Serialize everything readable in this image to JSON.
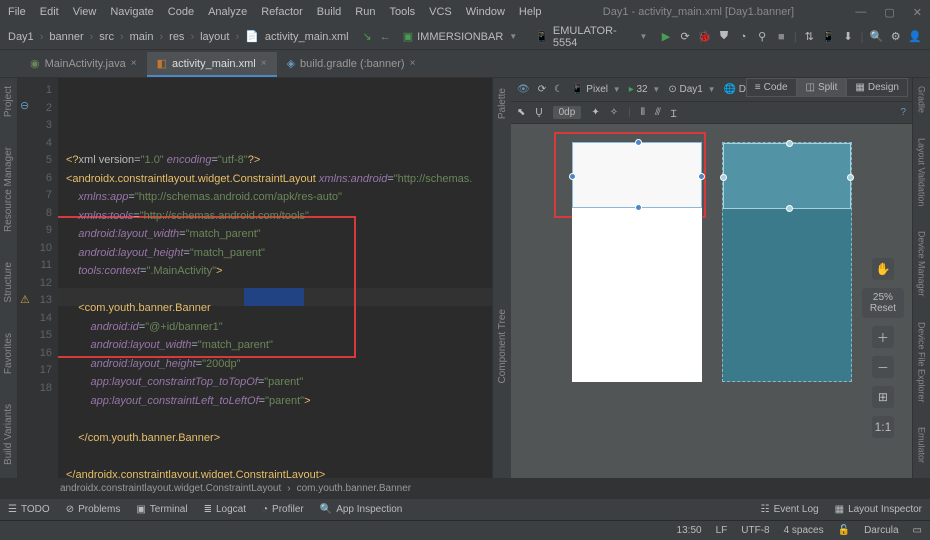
{
  "menu": [
    "File",
    "Edit",
    "View",
    "Navigate",
    "Code",
    "Analyze",
    "Refactor",
    "Build",
    "Run",
    "Tools",
    "VCS",
    "Window",
    "Help"
  ],
  "title": "Day1 - activity_main.xml [Day1.banner]",
  "breadcrumbs": [
    "Day1",
    "banner",
    "src",
    "main",
    "res",
    "layout",
    "activity_main.xml"
  ],
  "toolbar": {
    "config": "IMMERSIONBAR",
    "device": "EMULATOR-5554"
  },
  "tabs": [
    {
      "label": "MainActivity.java",
      "active": false
    },
    {
      "label": "activity_main.xml",
      "active": true
    },
    {
      "label": "build.gradle (:banner)",
      "active": false
    }
  ],
  "left_tools": [
    "Project",
    "Resource Manager",
    "Structure",
    "Favorites",
    "Build Variants"
  ],
  "right_tools": [
    "Gradle",
    "Layout Validation",
    "Device Manager",
    "Device File Explorer",
    "Emulator"
  ],
  "code": {
    "lines": [
      {
        "n": 1,
        "text": "<?xml version=\"1.0\" encoding=\"utf-8\"?>"
      },
      {
        "n": 2,
        "text": "<androidx.constraintlayout.widget.ConstraintLayout xmlns:android=\"http://schemas."
      },
      {
        "n": 3,
        "text": "    xmlns:app=\"http://schemas.android.com/apk/res-auto\""
      },
      {
        "n": 4,
        "text": "    xmlns:tools=\"http://schemas.android.com/tools\""
      },
      {
        "n": 5,
        "text": "    android:layout_width=\"match_parent\""
      },
      {
        "n": 6,
        "text": "    android:layout_height=\"match_parent\""
      },
      {
        "n": 7,
        "text": "    tools:context=\".MainActivity\">"
      },
      {
        "n": 8,
        "text": ""
      },
      {
        "n": 9,
        "text": "    <com.youth.banner.Banner"
      },
      {
        "n": 10,
        "text": "        android:id=\"@+id/banner1\""
      },
      {
        "n": 11,
        "text": "        android:layout_width=\"match_parent\""
      },
      {
        "n": 12,
        "text": "        android:layout_height=\"200dp\""
      },
      {
        "n": 13,
        "text": "        app:layout_constraintTop_toTopOf=\"parent\""
      },
      {
        "n": 14,
        "text": "        app:layout_constraintLeft_toLeftOf=\"parent\">"
      },
      {
        "n": 15,
        "text": ""
      },
      {
        "n": 16,
        "text": "    </com.youth.banner.Banner>"
      },
      {
        "n": 17,
        "text": ""
      },
      {
        "n": 18,
        "text": "</androidx.constraintlayout.widget.ConstraintLayout>"
      }
    ]
  },
  "code_breadcrumb": [
    "androidx.constraintlayout.widget.ConstraintLayout",
    "com.youth.banner.Banner"
  ],
  "designer": {
    "view_modes": [
      "Code",
      "Split",
      "Design"
    ],
    "active_view": "Split",
    "palette_label": "Palette",
    "component_label": "Component Tree",
    "toolbar": {
      "pixel": "Pixel",
      "api": "32",
      "theme": "Day1",
      "locale": "Default (en-us)",
      "dp_badge": "0dp"
    },
    "zoom": {
      "pct": "25%",
      "reset": "Reset"
    }
  },
  "bottom_tools": [
    "TODO",
    "Problems",
    "Terminal",
    "Logcat",
    "Profiler",
    "App Inspection"
  ],
  "bottom_right": [
    "Event Log",
    "Layout Inspector"
  ],
  "status": {
    "pos": "13:50",
    "lf": "LF",
    "enc": "UTF-8",
    "indent": "4 spaces",
    "branch": "Darcula"
  }
}
